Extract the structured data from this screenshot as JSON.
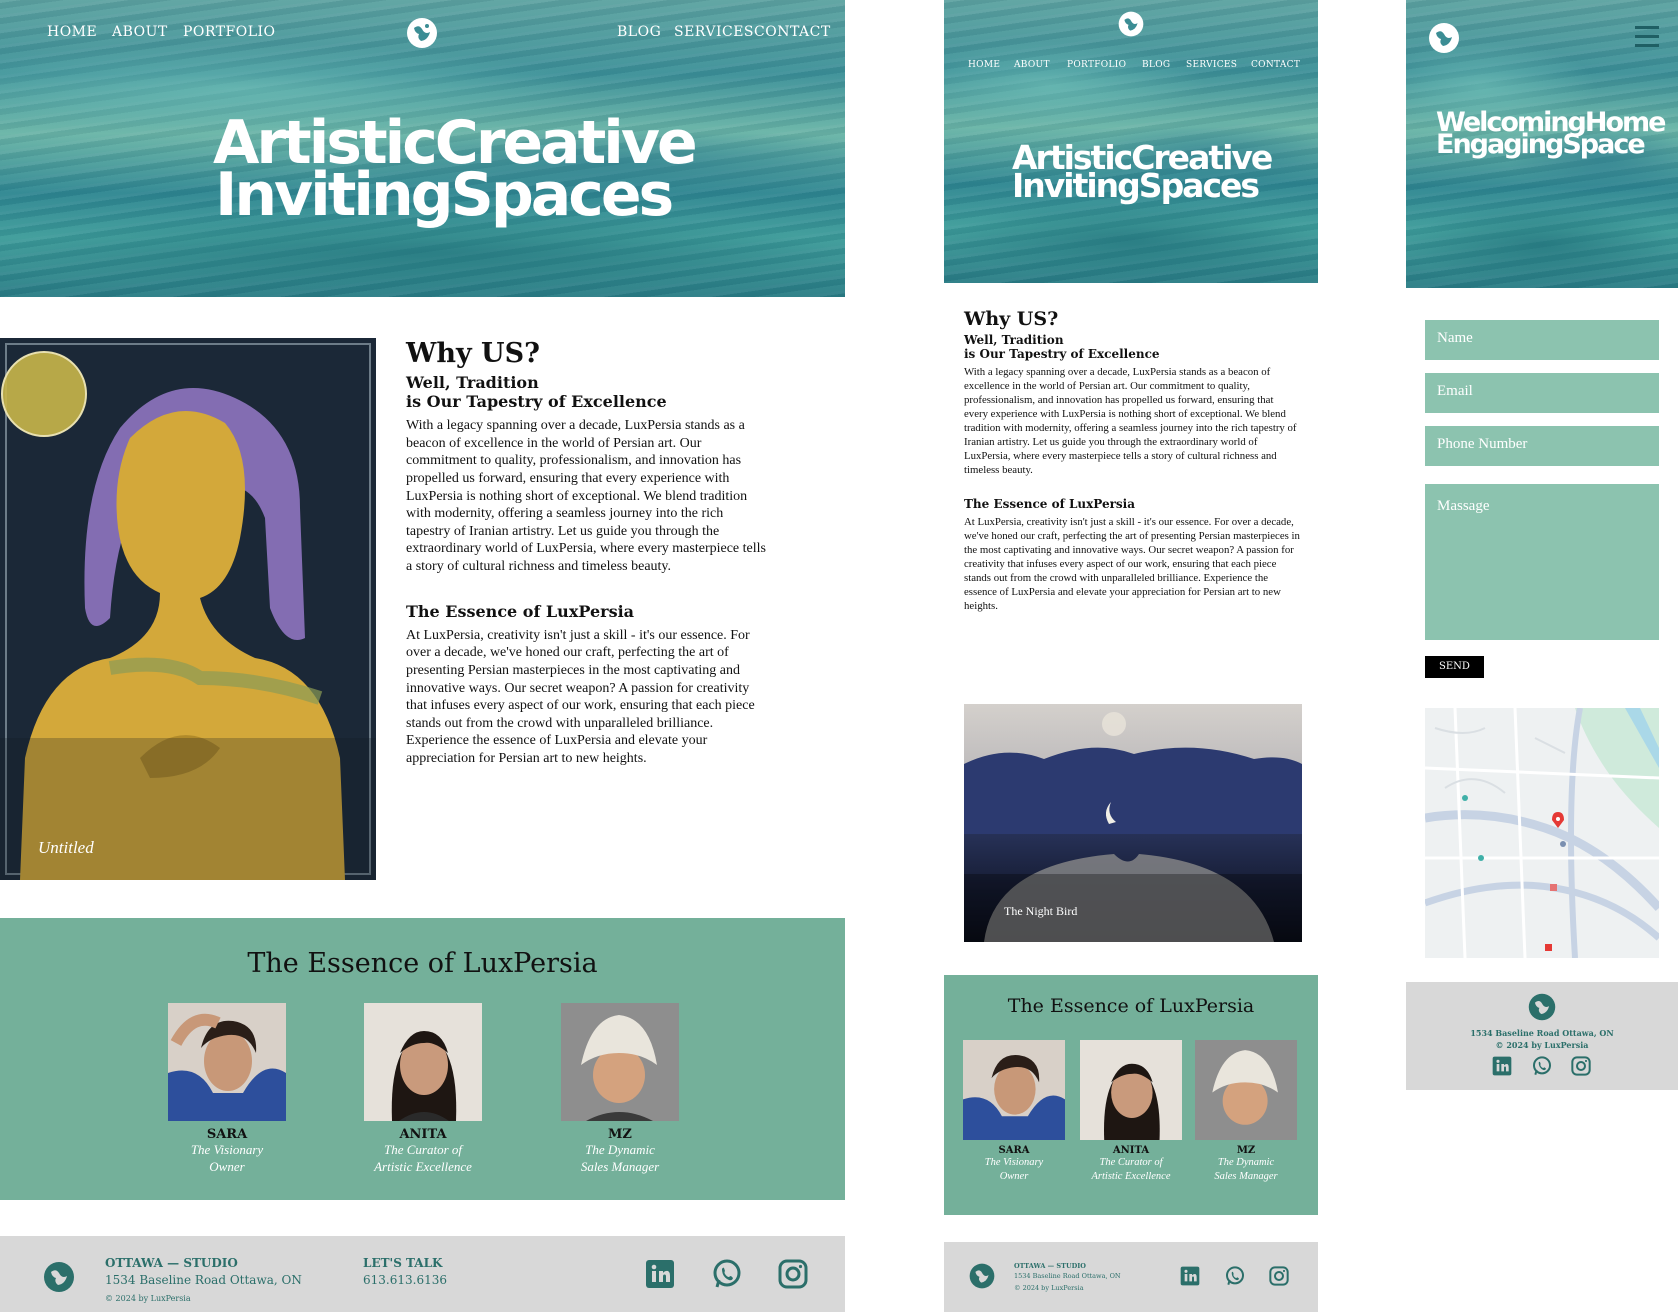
{
  "nav": {
    "home": "HOME",
    "about": "ABOUT",
    "portfolio": "PORTFOLIO",
    "blog": "BLOG",
    "services": "SERVICES",
    "contact": "CONTACT"
  },
  "hero_desktop": {
    "line1": "ArtisticCreative",
    "line2": "InvitingSpaces"
  },
  "hero_mobile": {
    "line1": "WelcomingHome",
    "line2": "EngagingSpace"
  },
  "why": {
    "title": "Why US?",
    "sub1": "Well, Tradition",
    "sub2": "is Our Tapestry of Excellence",
    "body": "With a legacy spanning over a decade, LuxPersia stands as a beacon of excellence in the world of Persian art. Our commitment to quality, professionalism, and innovation has propelled us forward, ensuring that every experience with LuxPersia is nothing short of exceptional. We blend tradition with modernity, offering a seamless journey into the rich tapestry of Iranian artistry. Let us guide you through the extraordinary world of LuxPersia, where every masterpiece tells a story of cultural richness and timeless beauty."
  },
  "essence": {
    "title": "The Essence of LuxPersia",
    "body": "At LuxPersia, creativity isn't just a skill - it's our essence. For over a decade, we've honed our craft, perfecting the art of presenting Persian masterpieces in the most captivating and innovative ways. Our secret weapon? A passion for creativity that infuses every aspect of our work, ensuring that each piece stands out from the crowd with unparalleled brilliance. Experience the essence of LuxPersia and elevate your appreciation for Persian art to new heights."
  },
  "artworks": {
    "main_caption": "Untitled",
    "tablet_caption": "The Night Bird"
  },
  "team": {
    "title": "The Essence of LuxPersia",
    "members": [
      {
        "name": "SARA",
        "role1": "The Visionary",
        "role2": "Owner"
      },
      {
        "name": "ANITA",
        "role1": "The Curator of",
        "role2": "Artistic Excellence"
      },
      {
        "name": "MZ",
        "role1": "The Dynamic",
        "role2": "Sales Manager"
      }
    ]
  },
  "footer": {
    "studio": "OTTAWA — STUDIO",
    "address": "1534 Baseline Road Ottawa, ON",
    "copyright": "© 2024 by LuxPersia",
    "talk": "LET'S TALK",
    "phone": "613.613.6136",
    "mobile_address": "1534 Baseline Road Ottawa, ON"
  },
  "form": {
    "name": "Name",
    "email": "Email",
    "phone": "Phone Number",
    "message": "Massage",
    "send": "SEND"
  },
  "colors": {
    "teal_band": "#74b09a",
    "field": "#8cc3af",
    "footer": "#d8d8d8",
    "footer_text": "#2b6f6a"
  }
}
